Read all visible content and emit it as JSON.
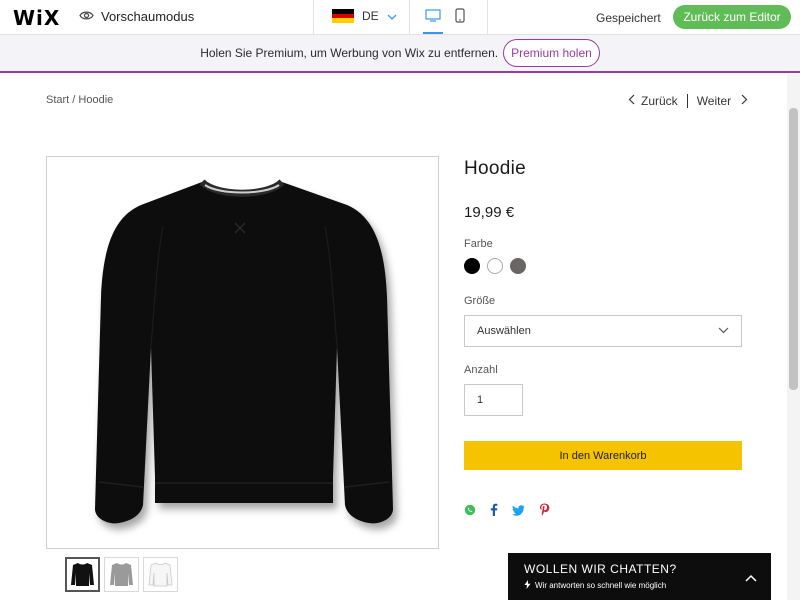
{
  "topbar": {
    "logo": "WiX",
    "preview_label": "Vorschaumodus",
    "language": "DE",
    "saved_label": "Gespeichert",
    "back_to_editor": "Zurück zum Editor"
  },
  "banner": {
    "text": "Holen Sie Premium, um Werbung von Wix zu entfernen.",
    "button": "Premium holen"
  },
  "breadcrumb": "Start / Hoodie",
  "pager": {
    "back": "Zurück",
    "next": "Weiter"
  },
  "product": {
    "title": "Hoodie",
    "price": "19,99 €",
    "color_label": "Farbe",
    "colors": [
      "#000000",
      "#ffffff",
      "#6b6565"
    ],
    "size_label": "Größe",
    "size_placeholder": "Auswählen",
    "quantity_label": "Anzahl",
    "quantity_value": "1",
    "add_to_cart": "In den Warenkorb"
  },
  "share_icons": [
    "whatsapp-icon",
    "facebook-icon",
    "twitter-icon",
    "pinterest-icon"
  ],
  "chat": {
    "title": "WOLLEN WIR CHATTEN?",
    "subtitle": "Wir antworten so schnell wie möglich"
  },
  "colors": {
    "accent_green": "#60bc57",
    "premium_purple": "#9b3b9b",
    "cart_yellow": "#f5c300",
    "device_blue": "#3899ec"
  }
}
